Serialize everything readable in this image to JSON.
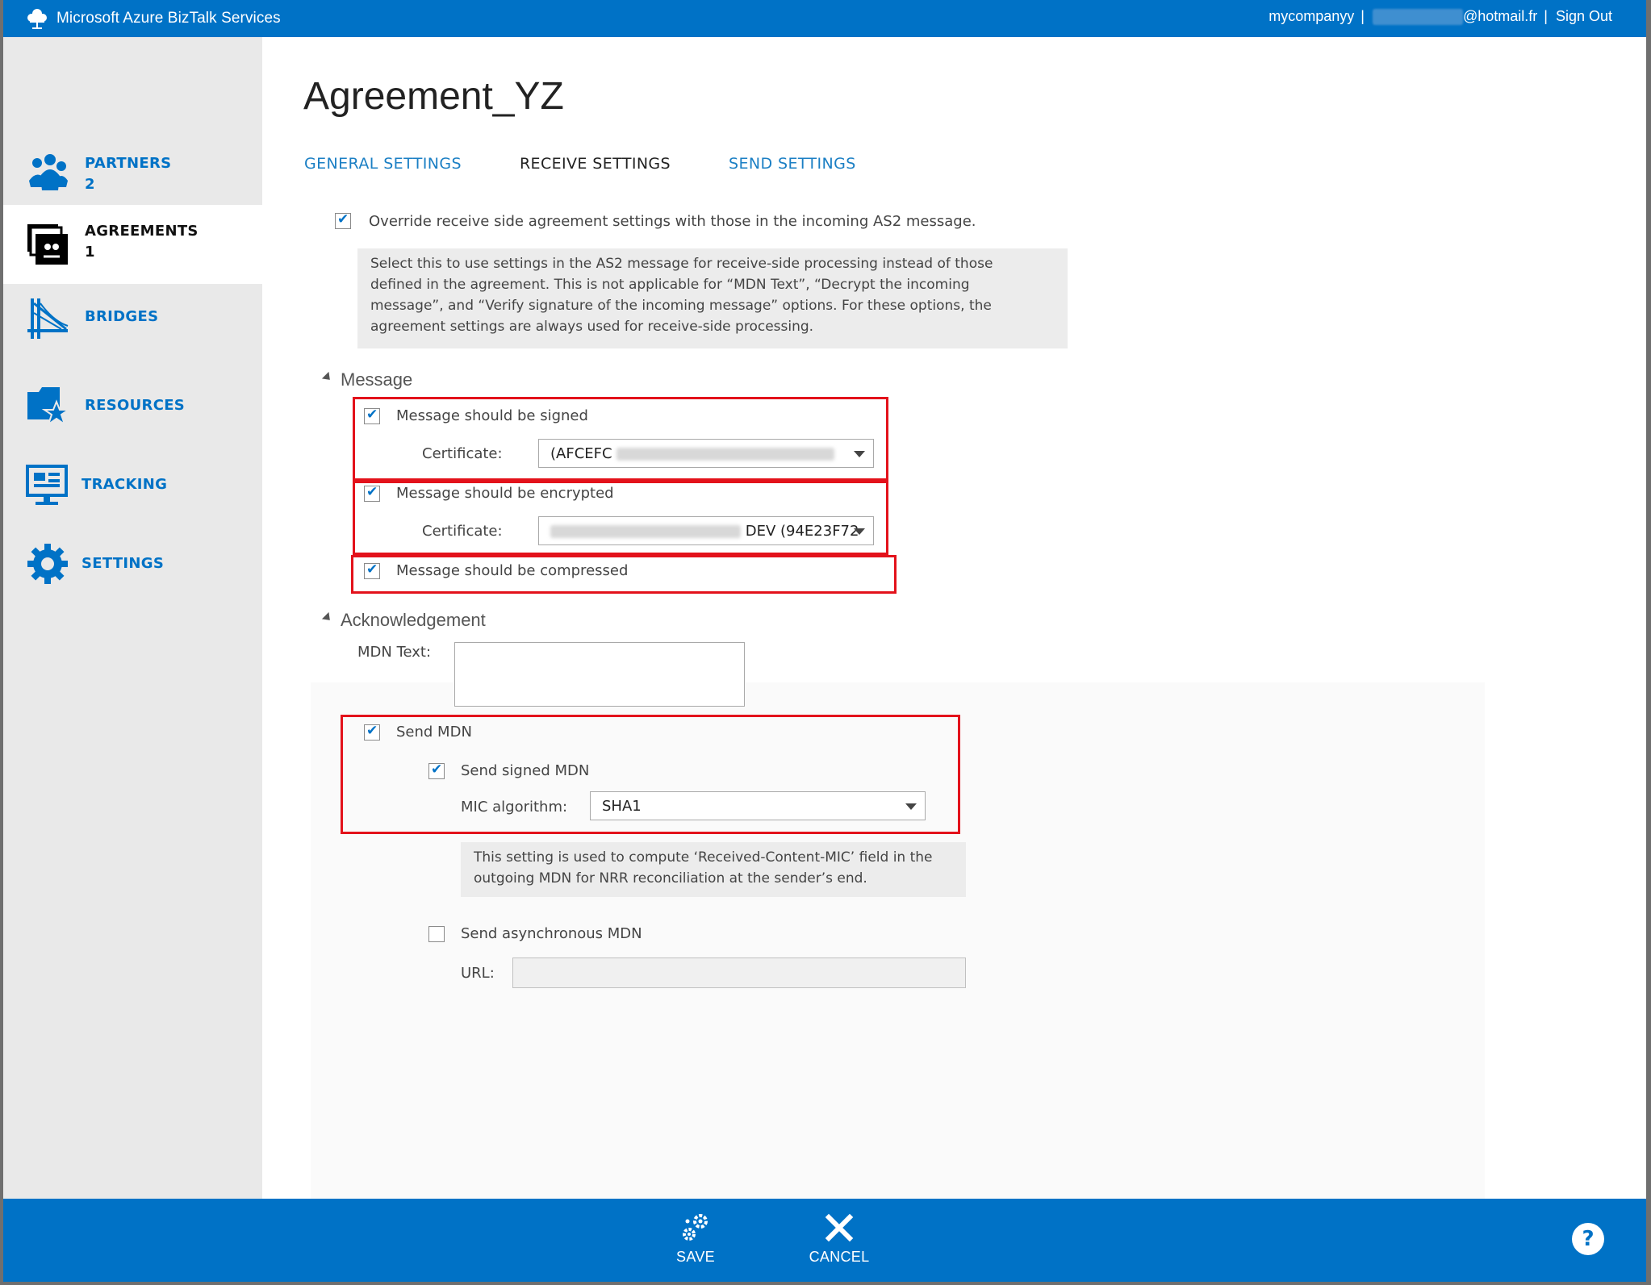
{
  "app": {
    "title": "Microsoft Azure BizTalk Services",
    "account_name": "mycompanyy",
    "account_separator": "|",
    "email_suffix": "@hotmail.fr",
    "sign_out": "Sign Out",
    "accent_color": "#0072c6"
  },
  "sidebar": {
    "items": [
      {
        "label": "PARTNERS",
        "count": "2",
        "icon": "partners-icon"
      },
      {
        "label": "AGREEMENTS",
        "count": "1",
        "icon": "agreements-icon",
        "active": true
      },
      {
        "label": "BRIDGES",
        "count": "",
        "icon": "bridges-icon"
      },
      {
        "label": "RESOURCES",
        "count": "",
        "icon": "resources-icon"
      },
      {
        "label": "TRACKING",
        "count": "",
        "icon": "tracking-icon"
      },
      {
        "label": "SETTINGS",
        "count": "",
        "icon": "settings-icon"
      }
    ]
  },
  "page": {
    "title": "Agreement_YZ",
    "tabs": [
      {
        "label": "GENERAL SETTINGS",
        "active": false
      },
      {
        "label": "RECEIVE SETTINGS",
        "active": true
      },
      {
        "label": "SEND SETTINGS",
        "active": false
      }
    ]
  },
  "override": {
    "label": "Override receive side agreement settings with those in the incoming AS2 message.",
    "checked": true,
    "info_lines": [
      "Select this to use settings in the AS2 message for receive-side processing instead of those",
      "defined in the agreement. This is not applicable for “MDN Text”, “Decrypt the incoming",
      "message”, and “Verify signature of the incoming message” options. For these options, the",
      "agreement settings are always used for receive-side processing."
    ]
  },
  "message": {
    "section_title": "Message",
    "signed_label": "Message should be signed",
    "signed_cert_label": "Certificate:",
    "signed_cert_value": "(AFCEFC",
    "encrypted_label": "Message should be encrypted",
    "encrypted_cert_label": "Certificate:",
    "encrypted_cert_value": "DEV (94E23F72",
    "compressed_label": "Message should be compressed"
  },
  "ack": {
    "section_title": "Acknowledgement",
    "mdn_text_label": "MDN Text:",
    "send_mdn_label": "Send MDN",
    "send_signed_mdn_label": "Send signed MDN",
    "mic_label": "MIC algorithm:",
    "mic_value": "SHA1",
    "mic_info_lines": [
      "This setting is used to compute ‘Received-Content-MIC’ field in the",
      "outgoing MDN for NRR reconciliation at the sender’s end."
    ],
    "async_label": "Send asynchronous MDN",
    "url_label": "URL:"
  },
  "footer": {
    "save_label": "SAVE",
    "cancel_label": "CANCEL",
    "help_label": "?"
  }
}
